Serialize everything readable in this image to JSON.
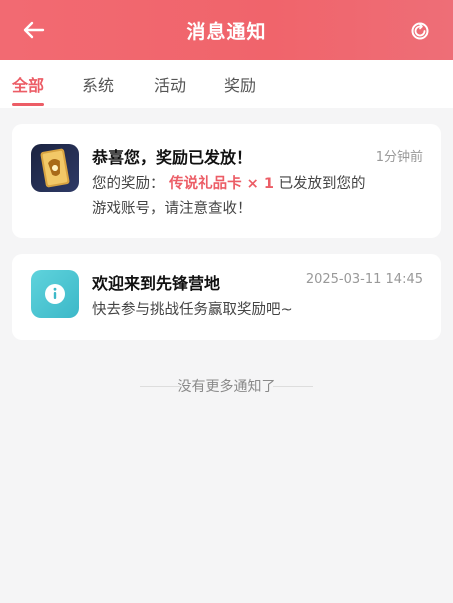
{
  "header": {
    "title": "消息通知",
    "back_icon": "back-arrow-icon",
    "refresh_icon": "refresh-icon"
  },
  "tabs": [
    {
      "label": "全部",
      "active": true
    },
    {
      "label": "系统",
      "active": false
    },
    {
      "label": "活动",
      "active": false
    },
    {
      "label": "奖励",
      "active": false
    }
  ],
  "notifications": [
    {
      "title": "恭喜您，奖励已发放！",
      "time": "1分钟前",
      "body_prefix": "您的奖励：",
      "body_highlight": "传说礼品卡 × 1",
      "body_suffix_line1": "已发放到您的",
      "body_line2": "游戏账号，请注意查收！",
      "icon": "game-card-icon"
    },
    {
      "title": "欢迎来到先锋营地",
      "time": "2025-03-11 14:45",
      "body": "快去参与挑战任务赢取奖励吧~",
      "icon": "info-icon"
    }
  ],
  "footer": {
    "note": "没有更多通知了"
  },
  "colors": {
    "accent": "#ec5d66",
    "header": "#f0646b",
    "info": "#4cc4d0"
  }
}
